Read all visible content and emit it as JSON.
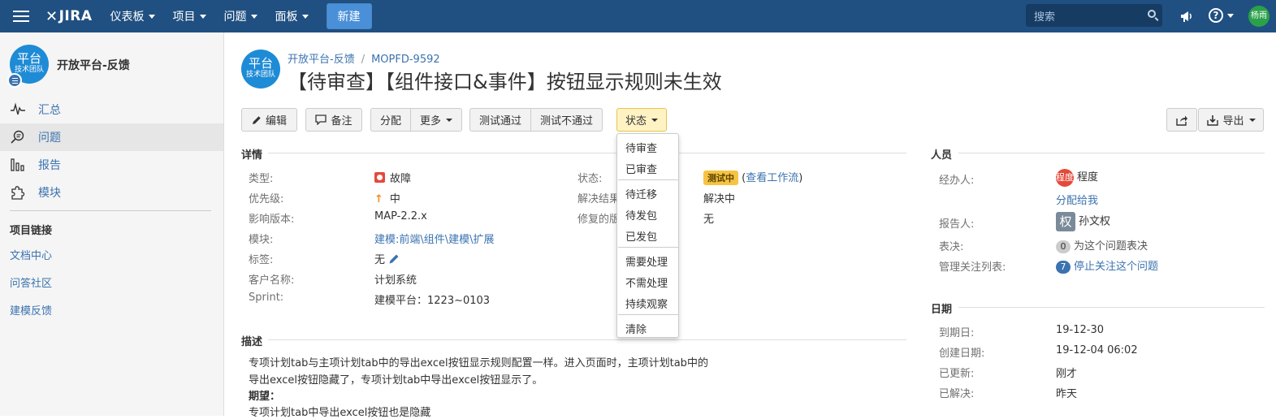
{
  "topnav": {
    "logo": "JIRA",
    "menu": [
      {
        "label": "仪表板"
      },
      {
        "label": "项目"
      },
      {
        "label": "问题"
      },
      {
        "label": "面板"
      }
    ],
    "create_label": "新建",
    "search_placeholder": "搜索",
    "user_avatar": "杨雨"
  },
  "sidebar": {
    "project_avatar_big": "平台",
    "project_avatar_small": "技术团队",
    "project_name": "开放平台-反馈",
    "items": [
      {
        "label": "汇总",
        "icon": "activity-icon"
      },
      {
        "label": "问题",
        "icon": "issues-search-icon"
      },
      {
        "label": "报告",
        "icon": "reports-icon"
      },
      {
        "label": "模块",
        "icon": "puzzle-icon"
      }
    ],
    "links_heading": "项目链接",
    "links": [
      {
        "label": "文档中心"
      },
      {
        "label": "问答社区"
      },
      {
        "label": "建模反馈"
      }
    ]
  },
  "issue": {
    "avatar_big": "平台",
    "avatar_small": "技术团队",
    "breadcrumb_project": "开放平台-反馈",
    "breadcrumb_sep": "/",
    "breadcrumb_key": "MOPFD-9592",
    "summary": "【待审查】【组件接口&事件】按钮显示规则未生效"
  },
  "toolbar": {
    "edit": "编辑",
    "comment": "备注",
    "assign": "分配",
    "more": "更多",
    "test_pass": "测试通过",
    "test_fail": "测试不通过",
    "status": "状态",
    "export": "导出"
  },
  "status_dropdown": {
    "groups": [
      [
        "待审查",
        "已审查"
      ],
      [
        "待迁移",
        "待发包",
        "已发包"
      ],
      [
        "需要处理",
        "不需处理",
        "持续观察"
      ],
      [
        "清除"
      ]
    ]
  },
  "details": {
    "heading": "详情",
    "left": [
      {
        "label": "类型:",
        "value": "故障"
      },
      {
        "label": "优先级:",
        "value": "中"
      },
      {
        "label": "影响版本:",
        "value": "MAP-2.2.x"
      },
      {
        "label": "模块:",
        "value": "建模:前端\\组件\\建模\\扩展"
      },
      {
        "label": "标签:",
        "value": "无"
      },
      {
        "label": "客户名称:",
        "value": "计划系统"
      },
      {
        "label": "Sprint:",
        "value": "建模平台：1223~0103"
      }
    ],
    "right": [
      {
        "label": "状态:",
        "value": "测试中",
        "extra_open": "(",
        "extra_link": "查看工作流",
        "extra_close": ")"
      },
      {
        "label": "解决结果",
        "value": "解决中"
      },
      {
        "label": "修复的版",
        "value": "无"
      }
    ]
  },
  "description": {
    "heading": "描述",
    "lines": [
      "专项计划tab与主项计划tab中的导出excel按钮显示规则配置一样。进入页面时，主项计划tab中的",
      "导出excel按钮隐藏了，专项计划tab中导出excel按钮显示了。",
      "期望：",
      "专项计划tab中导出excel按钮也是隐藏"
    ]
  },
  "people": {
    "heading": "人员",
    "assignee_label": "经办人:",
    "assignee_avatar": "程度",
    "assignee_name": "程度",
    "assign_to_me": "分配给我",
    "reporter_label": "报告人:",
    "reporter_avatar": "权",
    "reporter_name": "孙文权",
    "votes_label": "表决:",
    "votes_count": "0",
    "votes_link": "为这个问题表决",
    "watchers_label": "管理关注列表:",
    "watchers_count": "7",
    "watchers_link": "停止关注这个问题"
  },
  "dates": {
    "heading": "日期",
    "rows": [
      {
        "label": "到期日:",
        "value": "19-12-30"
      },
      {
        "label": "创建日期:",
        "value": "19-12-04 06:02"
      },
      {
        "label": "已更新:",
        "value": "刚才"
      },
      {
        "label": "已解决:",
        "value": "昨天"
      }
    ]
  },
  "colors": {
    "nav_bg": "#205081",
    "link": "#3b73af",
    "status_lozenge": "#f6c342"
  }
}
